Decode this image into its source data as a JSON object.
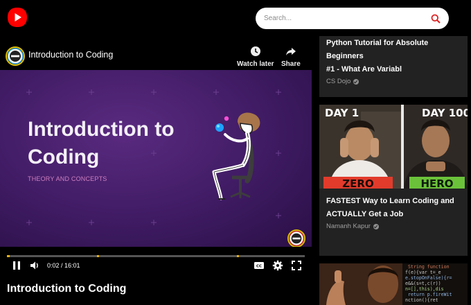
{
  "app": {
    "brand_color": "#ff0000"
  },
  "search": {
    "placeholder": "Search..."
  },
  "player": {
    "channel_icon": "channel-logo-icon",
    "title": "Introduction to Coding",
    "watch_later_label": "Watch later",
    "share_label": "Share",
    "slide": {
      "title_line1": "Introduction to",
      "title_line2": "Coding",
      "subtitle": "THEORY AND CONCEPTS"
    },
    "current_time": "0:02",
    "duration": "16:01",
    "time_display": "0:02 / 16:01",
    "progress_fraction": 0.002,
    "progress_color": "#e8b019",
    "cc_label": "CC"
  },
  "below_title": "Introduction to Coding",
  "sidebar": {
    "items": [
      {
        "title_line1": "Python Tutorial for Absolute Beginners",
        "title_line2": "#1 - What Are Variabl",
        "channel": "CS Dojo",
        "verified": true
      },
      {
        "thumb_left_top": "DAY 1",
        "thumb_left_bottom": "ZERO",
        "thumb_right_top": "DAY 100",
        "thumb_right_bottom": "HERO",
        "title_line1": "FASTEST Way to Learn Coding and",
        "title_line2": "ACTUALLY Get a Job",
        "channel": "Namanh Kapur",
        "verified": true
      },
      {
        "thumb_code_line1": "String function",
        "thumb_code_line2": "f(e){var t=_e",
        "thumb_code_line3": "e.stopOnFalse){r=",
        "thumb_code_line4": "e&&(s=t,c(r))",
        "thumb_code_line5": "n=[],this),dis",
        "thumb_code_line6": "return p.fireWit",
        "thumb_code_line7": "nction(){ret"
      }
    ]
  }
}
